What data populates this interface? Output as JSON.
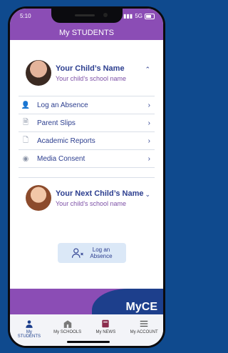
{
  "status": {
    "time": "5:10",
    "network": "5G"
  },
  "header": {
    "title": "My STUDENTS"
  },
  "children": [
    {
      "name": "Your Child’s Name",
      "school": "Your child’s school name"
    },
    {
      "name": "Your Next Child’s Name",
      "school": "Your child’s school name"
    }
  ],
  "menu": [
    {
      "label": "Log an Absence",
      "icon": "user-x-icon"
    },
    {
      "label": "Parent Slips",
      "icon": "slip-icon"
    },
    {
      "label": "Academic Reports",
      "icon": "report-icon"
    },
    {
      "label": "Media Consent",
      "icon": "camera-icon"
    }
  ],
  "absence_button": {
    "label": "Log an\nAbsence"
  },
  "brand": {
    "name": "MyCE"
  },
  "tabs": [
    {
      "label": "My STUDENTS",
      "icon": "person-icon",
      "active": true
    },
    {
      "label": "My SCHOOLS",
      "icon": "school-icon",
      "active": false
    },
    {
      "label": "My NEWS",
      "icon": "news-icon",
      "active": false
    },
    {
      "label": "My ACCOUNT",
      "icon": "menu-icon",
      "active": false
    }
  ],
  "colors": {
    "purple": "#8b4db5",
    "navy": "#1d3f8c",
    "background": "#0f4a8e"
  }
}
